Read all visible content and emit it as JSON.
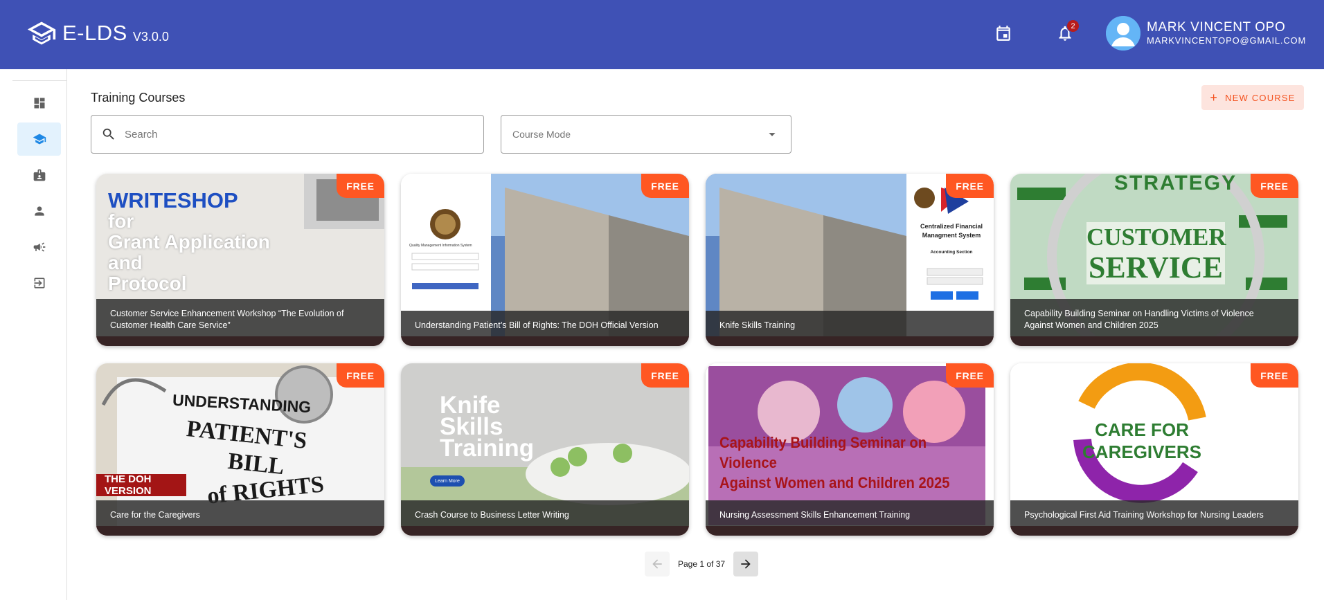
{
  "header": {
    "brand": "E-LDS",
    "version": "V3.0.0",
    "notification_count": "2",
    "user_name": "MARK VINCENT OPO",
    "user_email": "MARKVINCENTOPO@GMAIL.COM",
    "color": "#3f51b5"
  },
  "sidebar": {
    "items": [
      {
        "icon": "dashboard-icon",
        "active": false
      },
      {
        "icon": "school-icon",
        "active": true
      },
      {
        "icon": "badge-icon",
        "active": false
      },
      {
        "icon": "person-icon",
        "active": false
      },
      {
        "icon": "campaign-icon",
        "active": false
      },
      {
        "icon": "logout-icon",
        "active": false
      }
    ]
  },
  "main": {
    "title": "Training Courses",
    "new_course_label": "NEW COURSE",
    "search_placeholder": "Search",
    "course_mode_placeholder": "Course Mode",
    "accent": "#f4511e"
  },
  "courses": [
    {
      "title": "Customer Service Enhancement Workshop “The Evolution of Customer Health Care Service”",
      "tag": "FREE",
      "thumb_lines": [
        "WRITESHOP",
        "for",
        "Grant Application",
        "and",
        "Protocol"
      ]
    },
    {
      "title": "Understanding Patient’s Bill of Rights: The DOH Official Version",
      "tag": "FREE",
      "thumb_lines": [
        "Quality Management Information System"
      ]
    },
    {
      "title": "Knife Skills Training",
      "tag": "FREE",
      "thumb_lines": [
        "Centralized Financial Managment System",
        "Accounting Section"
      ]
    },
    {
      "title": "Capability Building Seminar on Handling Victims of Violence Against Women and Children 2025",
      "tag": "FREE",
      "thumb_lines": [
        "STRATEGY",
        "CUSTOMER",
        "SERVICE"
      ]
    },
    {
      "title": "Care for the Caregivers",
      "tag": "FREE",
      "thumb_lines": [
        "UNDERSTANDING",
        "PATIENT'S",
        "BILL",
        "of RIGHTS",
        "THE DOH VERSION"
      ]
    },
    {
      "title": "Crash Course to Business Letter Writing",
      "tag": "FREE",
      "thumb_lines": [
        "Knife",
        "Skills",
        "Training",
        "Learn More"
      ]
    },
    {
      "title": "Nursing Assessment Skills Enhancement Training",
      "tag": "FREE",
      "thumb_lines": [
        "Capability Building Seminar on Violence",
        "Against Women and Children 2025"
      ]
    },
    {
      "title": "Psychological First Aid Training Workshop for Nursing Leaders",
      "tag": "FREE",
      "thumb_lines": [
        "CARE FOR",
        "CAREGIVERS"
      ]
    }
  ],
  "pagination": {
    "text": "Page 1 of 37",
    "current": 1,
    "total": 37
  }
}
